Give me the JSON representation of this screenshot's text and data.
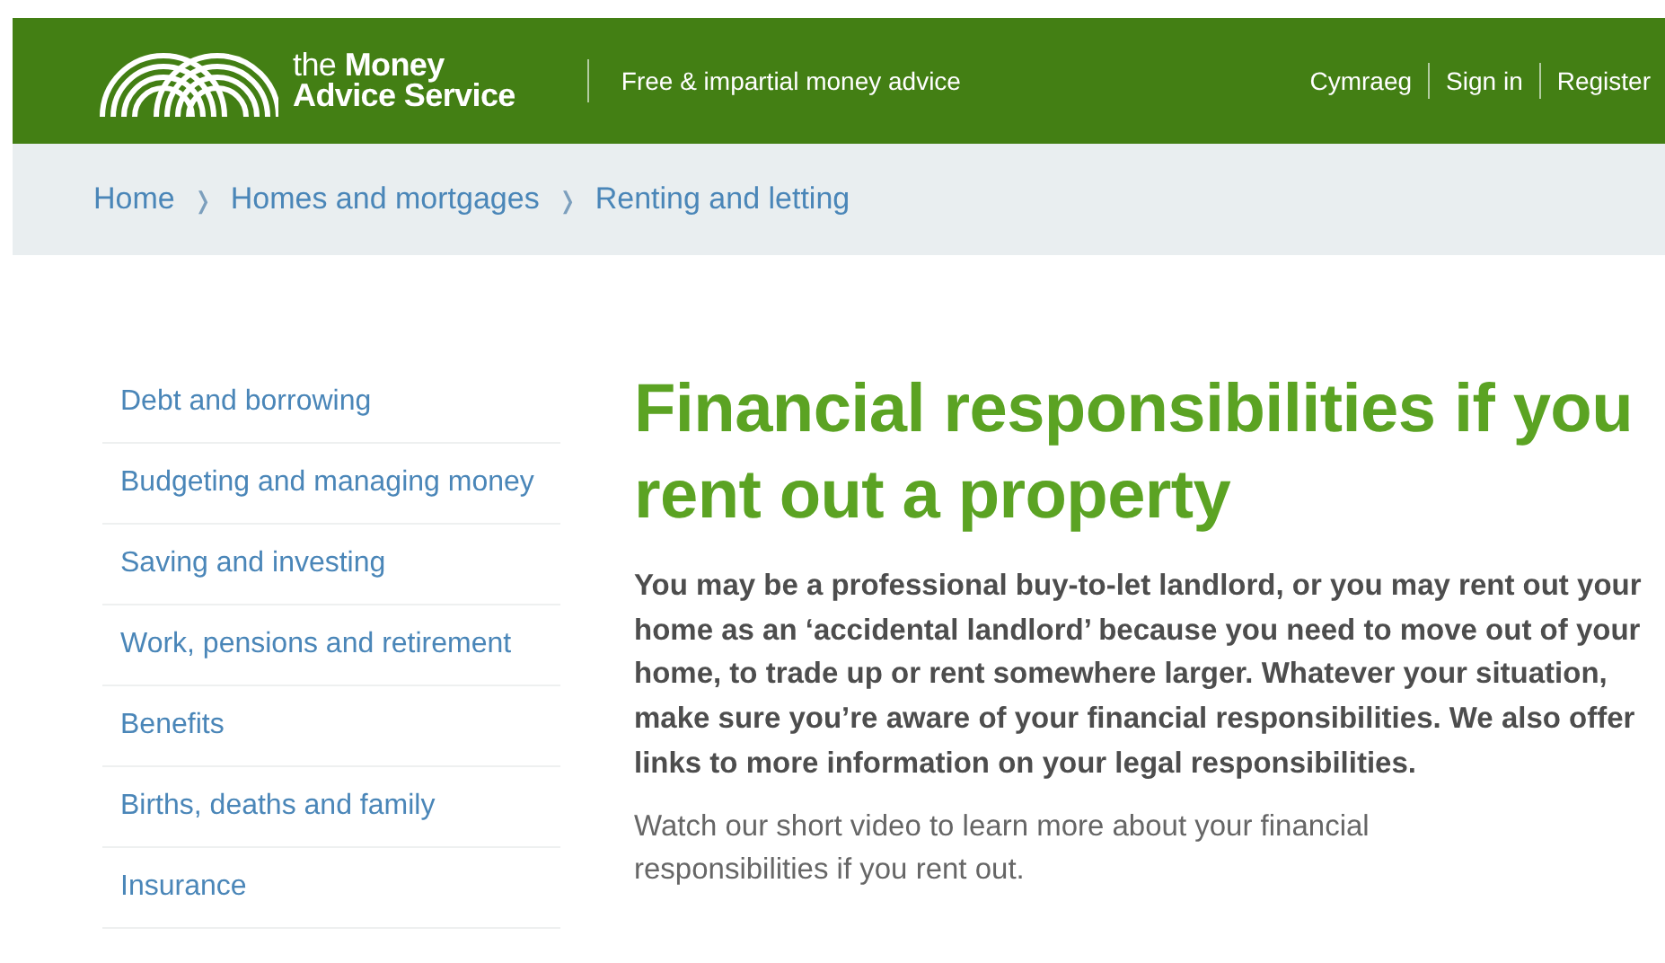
{
  "header": {
    "logo": {
      "line_1": "the **Money**",
      "line_2": "Advice Service"
    },
    "tagline": "Free & impartial money advice",
    "links": [
      {
        "label": "Cymraeg"
      },
      {
        "label": "Sign in"
      },
      {
        "label": "Register"
      }
    ]
  },
  "breadcrumb": [
    {
      "label": "Home"
    },
    {
      "label": "Homes and mortgages"
    },
    {
      "label": "Renting and letting"
    }
  ],
  "breadcrumb_separator": "❭",
  "sidebar": {
    "items": [
      {
        "label": "Debt and borrowing"
      },
      {
        "label": "Budgeting and managing money"
      },
      {
        "label": "Saving and investing"
      },
      {
        "label": "Work, pensions and retirement"
      },
      {
        "label": "Benefits"
      },
      {
        "label": "Births, deaths and family"
      },
      {
        "label": "Insurance"
      }
    ]
  },
  "article": {
    "title": "Financial responsibilities if you rent out a property",
    "intro": "You may be a professional buy-to-let landlord, or you may rent out your home as an ‘accidental landlord’ because you need to move out of your home, to trade up or rent somewhere larger. Whatever your situation, make sure you’re aware of your financial responsibilities. We also offer links to more information on your legal responsibilities.",
    "body": "Watch our short video to learn more about your financial responsibilities if you rent out."
  }
}
